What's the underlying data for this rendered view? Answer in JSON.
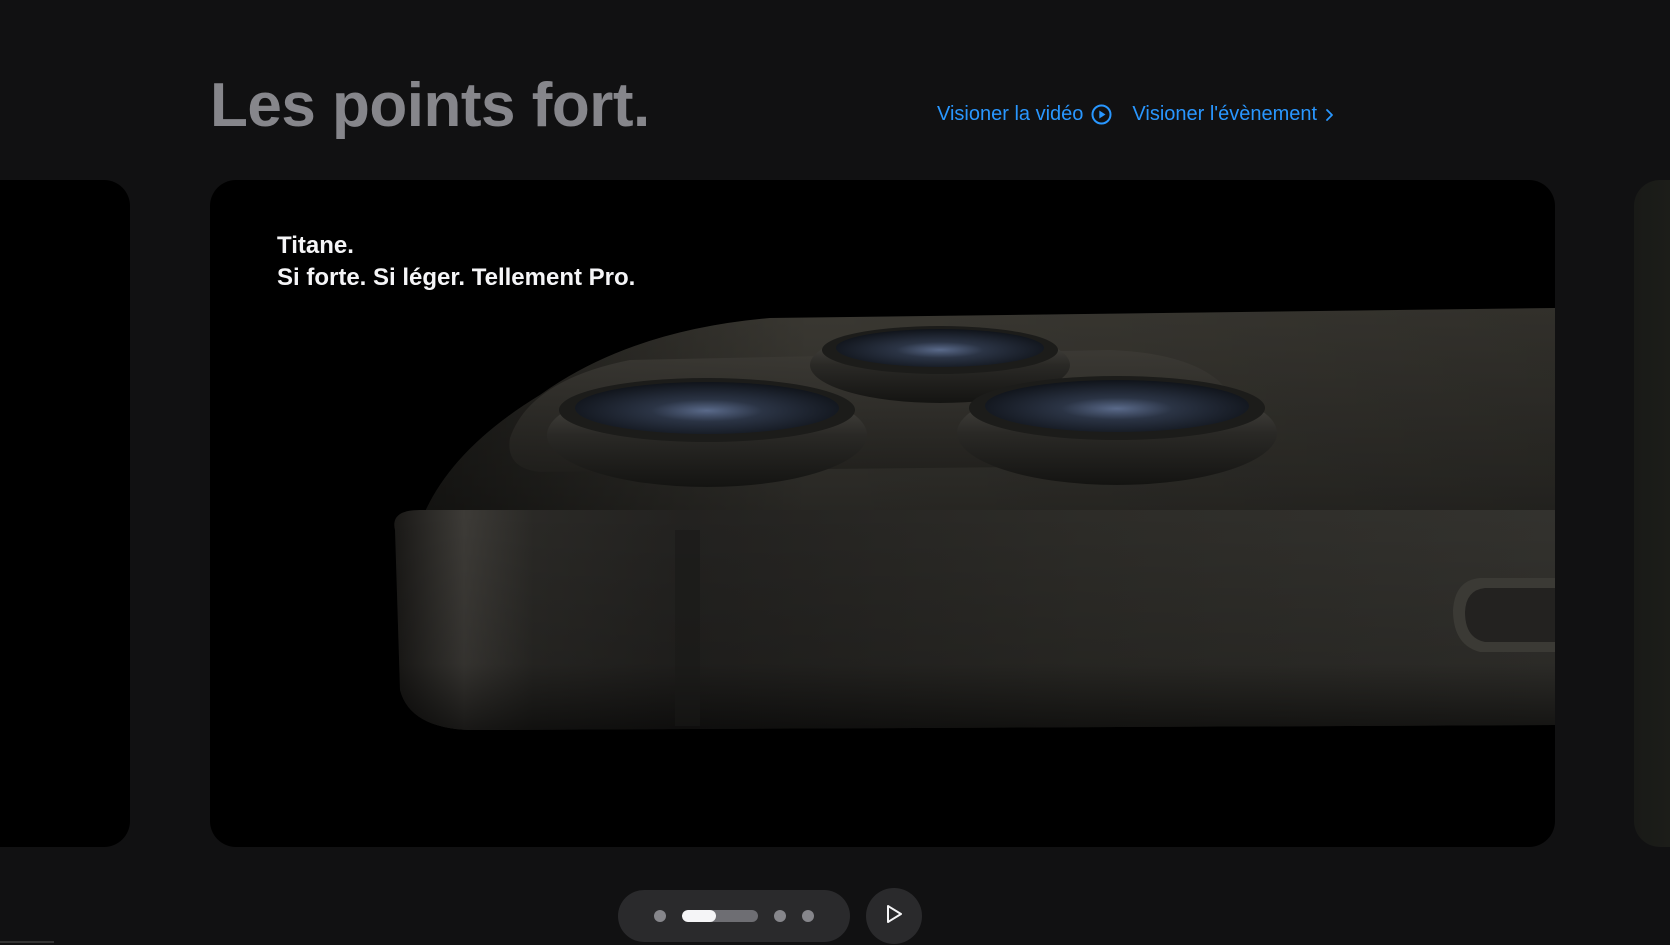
{
  "section": {
    "headline": "Les points fort.",
    "links": {
      "video_label": "Visioner la vidéo",
      "video_icon": "play-circle-icon",
      "event_label": "Visioner l'évènement",
      "event_icon": "chevron-right-icon"
    }
  },
  "gallery": {
    "active_card": {
      "line1": "Titane.",
      "line2": "Si forte. Si léger. Tellement Pro."
    },
    "pagination": {
      "total": 4,
      "active_index": 1,
      "active_progress": 0.45
    },
    "play_button_icon": "play-icon"
  },
  "colors": {
    "link": "#2997ff",
    "headline": "#86868b",
    "background": "#111112"
  }
}
